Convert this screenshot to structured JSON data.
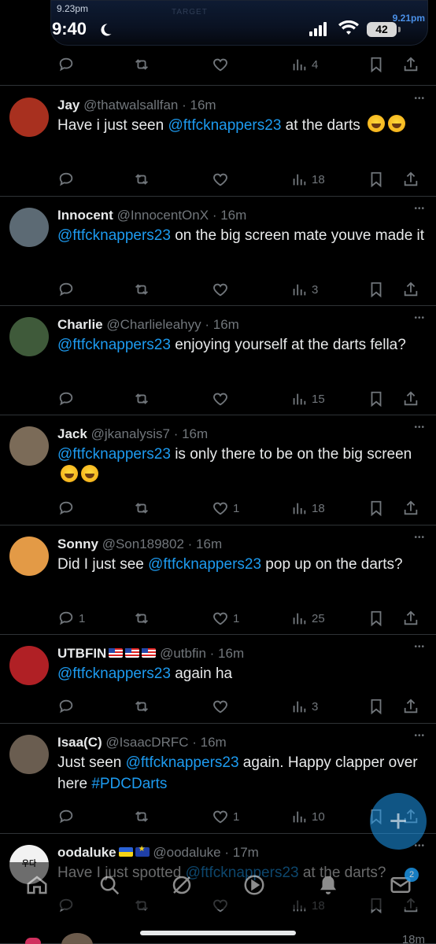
{
  "status_bar": {
    "time": "9:40",
    "battery": "42",
    "island_time_left": "9.23pm",
    "island_time_right": "9.21pm",
    "island_text": "TARGET"
  },
  "first_tweet_actions": {
    "views": "4"
  },
  "tweets": [
    {
      "name": "Jay",
      "handle": "@thatwalsallfan",
      "time": "· 16m",
      "text_parts": [
        [
          "",
          "Have i just seen "
        ],
        [
          "m",
          "@ftfcknappers23"
        ],
        [
          "",
          " at the darts "
        ],
        [
          "e",
          ""
        ],
        [
          "e",
          ""
        ]
      ],
      "replies": "",
      "likes": "",
      "views": "18",
      "avatar_color": "#a8301f"
    },
    {
      "name": "Innocent",
      "handle": "@InnocentOnX",
      "time": "· 16m",
      "text_parts": [
        [
          "m",
          "@ftfcknappers23"
        ],
        [
          "",
          " on the big screen mate youve made it"
        ]
      ],
      "replies": "",
      "likes": "",
      "views": "3",
      "avatar_color": "#5c6a74"
    },
    {
      "name": "Charlie",
      "handle": "@Charlieleahyy",
      "time": "· 16m",
      "text_parts": [
        [
          "m",
          "@ftfcknappers23"
        ],
        [
          "",
          " enjoying yourself at the darts fella?"
        ]
      ],
      "replies": "",
      "likes": "",
      "views": "15",
      "avatar_color": "#3f5a3a"
    },
    {
      "name": "Jack",
      "handle": "@jkanalysis7",
      "time": "· 16m",
      "text_parts": [
        [
          "m",
          "@ftfcknappers23"
        ],
        [
          "",
          " is only there to be on the big screen "
        ],
        [
          "e",
          ""
        ],
        [
          "e",
          ""
        ]
      ],
      "replies": "",
      "likes": "1",
      "views": "18",
      "avatar_color": "#7b6b58"
    },
    {
      "name": "Sonny",
      "handle": "@Son189802",
      "time": "· 16m",
      "text_parts": [
        [
          "",
          "Did I just see "
        ],
        [
          "m",
          "@ftfcknappers23"
        ],
        [
          "",
          " pop up on the darts?"
        ]
      ],
      "replies": "1",
      "likes": "1",
      "views": "25",
      "avatar_color": "#e39a46"
    },
    {
      "name": "UTBFIN",
      "flags": [
        "us",
        "us",
        "us"
      ],
      "handle": "@utbfin",
      "time": "· 16m",
      "text_parts": [
        [
          "m",
          "@ftfcknappers23"
        ],
        [
          "",
          " again ha"
        ]
      ],
      "replies": "",
      "likes": "",
      "views": "3",
      "avatar_color": "#b02025"
    },
    {
      "name": "Isaa(C)",
      "handle": "@IsaacDRFC",
      "time": "· 16m",
      "text_parts": [
        [
          "",
          "Just seen "
        ],
        [
          "m",
          "@ftfcknappers23"
        ],
        [
          "",
          " again. Happy clapper over here "
        ],
        [
          "m",
          "#PDCDarts"
        ]
      ],
      "replies": "",
      "likes": "1",
      "views": "10",
      "avatar_color": "#6a5d50"
    },
    {
      "name": "oodaluke",
      "flags": [
        "ua",
        "eu"
      ],
      "handle": "@oodaluke",
      "time": "· 17m",
      "text_parts": [
        [
          "",
          "Have I just spotted "
        ],
        [
          "m",
          "@ftfcknappers23"
        ],
        [
          "",
          " at the darts?"
        ]
      ],
      "replies": "",
      "likes": "",
      "views": "18",
      "avatar_color": "#f2f2f2",
      "avatar_text": "우다"
    }
  ],
  "nav": {
    "tabs": [
      "home-icon",
      "search-icon",
      "grok-icon",
      "video-icon",
      "notifications-icon",
      "messages-icon"
    ],
    "messages_badge": "2"
  },
  "partial_time": "18m"
}
